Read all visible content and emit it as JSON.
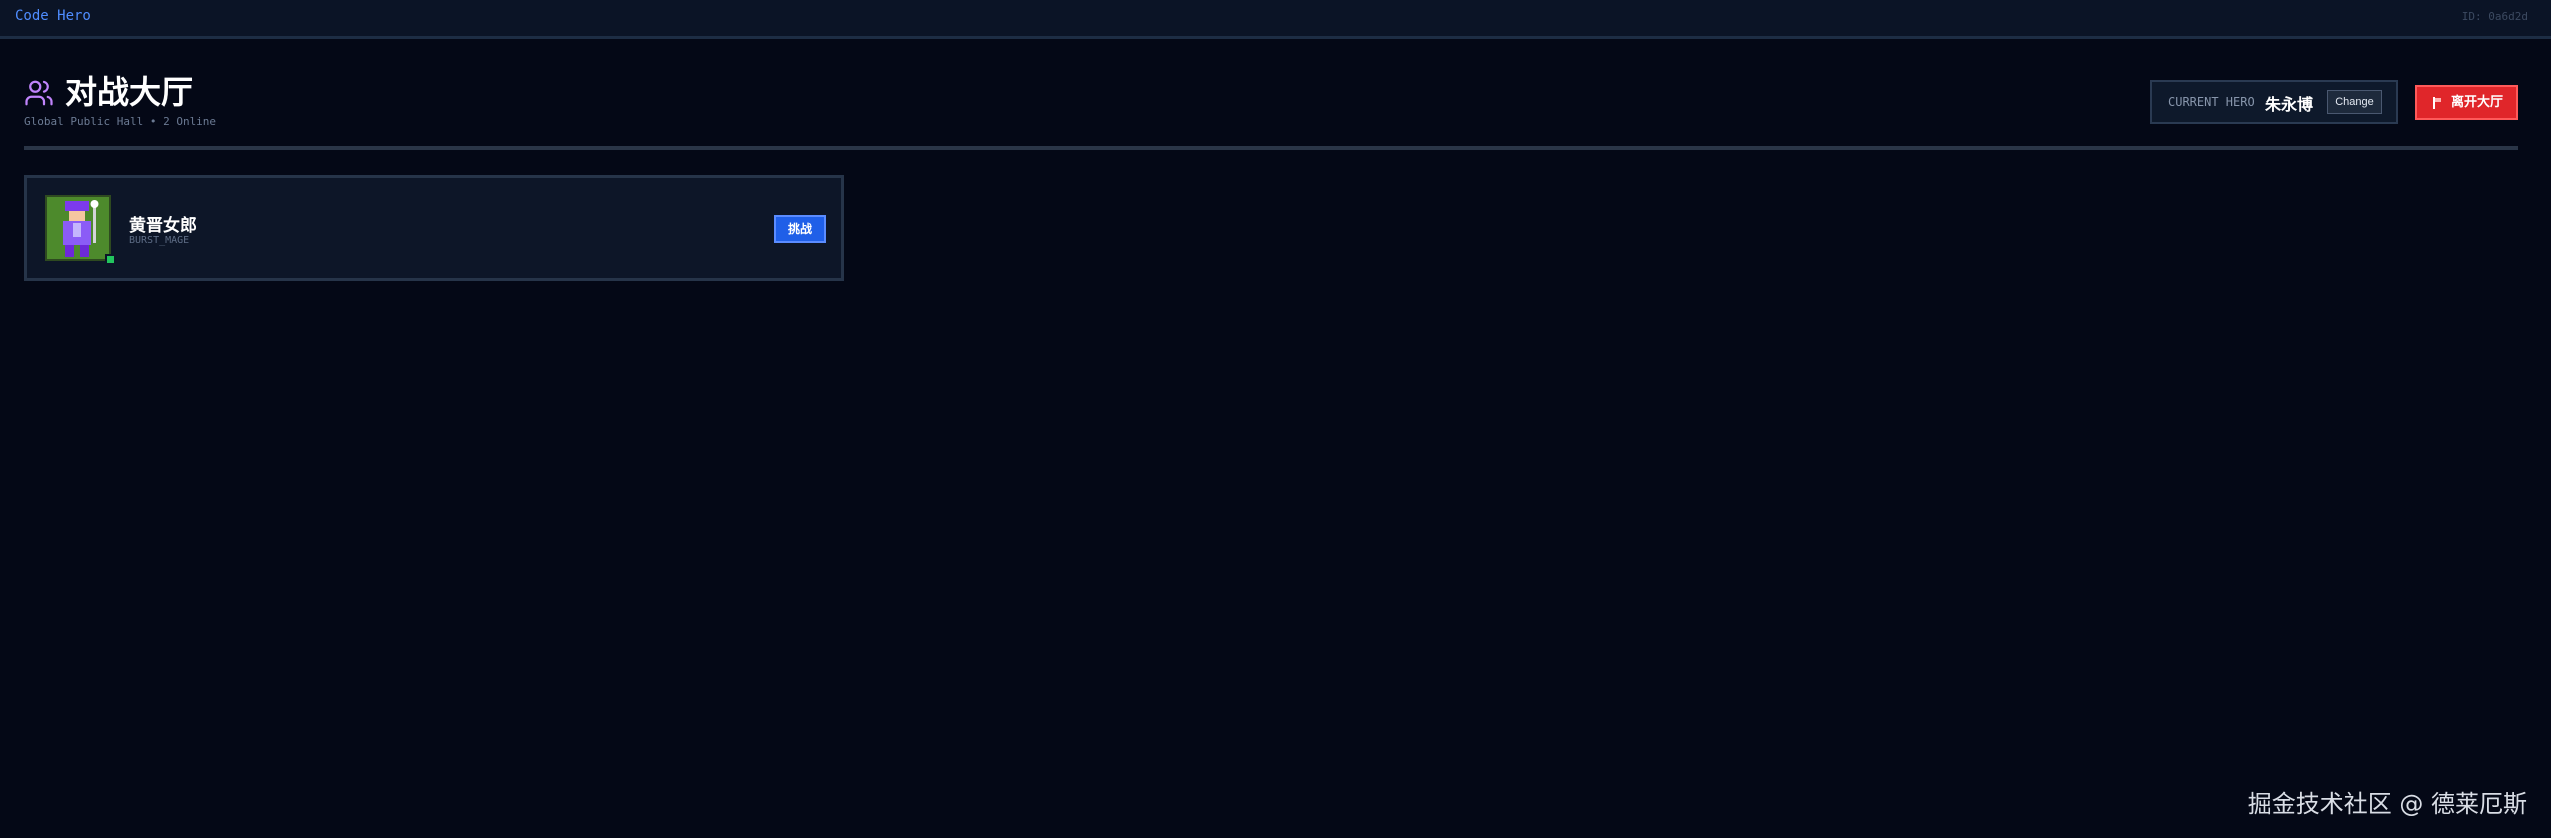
{
  "topbar": {
    "brand": "Code Hero",
    "session_id": "ID: 0a6d2d"
  },
  "header": {
    "icon": "users-icon",
    "title": "对战大厅",
    "subtitle": "Global Public Hall • 2 Online",
    "current_hero_label": "CURRENT HERO",
    "current_hero_name": "朱永博",
    "change_label": "Change",
    "leave_icon": "flag-icon",
    "leave_label": "离开大厅"
  },
  "players": [
    {
      "name": "黄晋女郎",
      "class": "BURST_MAGE",
      "status": "online",
      "challenge_label": "挑战"
    }
  ],
  "colors": {
    "background": "#040816",
    "accent_blue": "#1f5fe8",
    "danger_red": "#e0262a",
    "online_green": "#22c55e",
    "title_icon": "#c084fc"
  },
  "watermark": "掘金技术社区 @ 德莱厄斯"
}
